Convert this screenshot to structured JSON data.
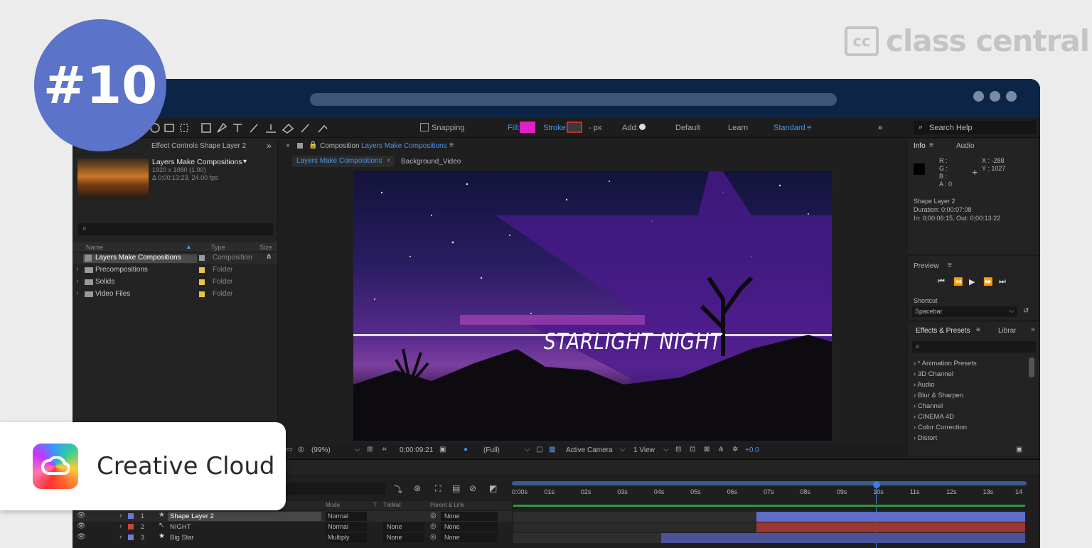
{
  "badge": {
    "number": "#10"
  },
  "brand": {
    "mark": "cc",
    "name": "class central"
  },
  "promo": {
    "product": "Creative Cloud"
  },
  "toolbar": {
    "snapping": "Snapping",
    "fill": "Fill:",
    "stroke": "Stroke:",
    "px": "- px",
    "add": "Add:",
    "workspaces": [
      "Default",
      "Learn",
      "Standard"
    ],
    "search_help": "Search Help"
  },
  "project": {
    "tab": "Effect Controls  Shape Layer 2",
    "comp_name": "Layers Make Compositions",
    "comp_res": "1920 x 1080 (1.00)",
    "comp_dur": "Δ 0;00:13:23, 24.00 fps",
    "search_placeholder": "",
    "headers": {
      "name": "Name",
      "type": "Type",
      "size": "Size"
    },
    "items": [
      {
        "name": "Layers Make Compositions",
        "type": "Composition",
        "color": "#9a9a9a"
      },
      {
        "name": "Precompositions",
        "type": "Folder",
        "color": "#e8c53c"
      },
      {
        "name": "Solids",
        "type": "Folder",
        "color": "#e8c53c"
      },
      {
        "name": "Video Files",
        "type": "Folder",
        "color": "#e8c53c"
      }
    ]
  },
  "composition": {
    "header_prefix": "Composition",
    "header_name": "Layers Make Compositions",
    "tabs": [
      "Layers Make Compositions",
      "Background_Video"
    ],
    "title_text": "STARLIGHT NIGHT",
    "footer": {
      "zoom": "(99%)",
      "timecode": "0;00:09:21",
      "resolution": "(Full)",
      "camera": "Active Camera",
      "views": "1 View",
      "exposure": "+0.0"
    }
  },
  "info": {
    "tabs": [
      "Info",
      "Audio"
    ],
    "rgba": [
      "R :",
      "G :",
      "B :",
      "A : 0"
    ],
    "coords": [
      "X : -288",
      "Y : 1027"
    ],
    "layer": "Shape Layer 2",
    "duration": "Duration: 0;00:07:08",
    "inout": "In: 0;00:06:15, Out: 0;00:13:22"
  },
  "preview": {
    "title": "Preview",
    "shortcut_label": "Shortcut",
    "shortcut_value": "Spacebar"
  },
  "effects": {
    "tabs": [
      "Effects & Presets",
      "Librar"
    ],
    "items": [
      "* Animation Presets",
      "3D Channel",
      "Audio",
      "Blur & Sharpen",
      "Channel",
      "CINEMA 4D",
      "Color Correction",
      "Distort"
    ]
  },
  "timeline": {
    "ruler": [
      "0:00s",
      "01s",
      "02s",
      "03s",
      "04s",
      "05s",
      "06s",
      "07s",
      "08s",
      "09s",
      "10s",
      "11s",
      "12s",
      "13s",
      "14"
    ],
    "headers": {
      "mode": "Mode",
      "t": "T",
      "trkmat": "TrkMat",
      "parent": "Parent & Link"
    },
    "layers": [
      {
        "num": "1",
        "name": "Shape Layer 2",
        "mode": "Normal",
        "trkmat": "",
        "parent": "None",
        "color": "#6f7bd6"
      },
      {
        "num": "2",
        "name": "NIGHT",
        "mode": "Normal",
        "trkmat": "None",
        "parent": "None",
        "color": "#c8443c"
      },
      {
        "num": "3",
        "name": "Big Star",
        "mode": "Multiply",
        "trkmat": "None",
        "parent": "None",
        "color": "#6f7bd6"
      }
    ]
  }
}
